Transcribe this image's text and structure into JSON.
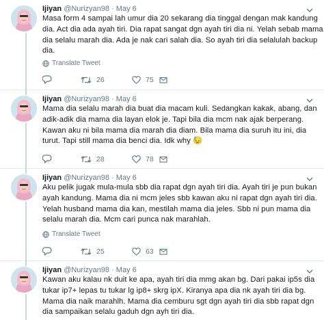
{
  "user": {
    "name": "Ijiyan",
    "handle": "@Nurizyan98",
    "separator": "·"
  },
  "translate_label": "Translate Tweet",
  "tweets": [
    {
      "date": "May 6",
      "lines": [
        "Masa form 4 sampai lah umur dia 20 sekarang dia tinggal dengan mak kandung",
        "dia. Act dia ada ayah tiri. Dia rapat sangat dgn ayah tiri dia ni. Yelah sebab mama",
        "dia selalu marah dia. Ada je nak cari salah dia. So ayah tiri dia selalulah backup",
        "dia."
      ],
      "replies": "",
      "retweets": "26",
      "likes": "75"
    },
    {
      "date": "May 6",
      "lines": [
        "Mama dia selalu marah dia buat dia macam kuli. Sedangkan kakak, abang,  dan",
        "adik-adik dia mama dia layan elok je. Tapi bila dia mcm nak ajak berperang.",
        "Kawan aku ni bila mama dia marah dia diam. Bila mama dia suruh itu ini, dia",
        "turut. Tapi still mama dia benci dia. Idk why"
      ],
      "emoji": "😓",
      "replies": "",
      "retweets": "28",
      "likes": "78"
    },
    {
      "date": "May 6",
      "lines": [
        "Aku pelik jugak mula-mula sbb dia rapat dgn ayah tiri dia. Ayah tiri je pun bukan",
        "ayah kandung. Mama dia ni mcm jeles sbb kawan aku ni rapat dgn ayah tiri dia.",
        "Yelah husband mama dia kan, mestilah mama dia jeles. Sbb ni pun mama dia",
        "selalu marah dia. Mcm cari punca nak marahlah."
      ],
      "replies": "",
      "retweets": "25",
      "likes": "63"
    },
    {
      "date": "May 6",
      "lines": [
        "Kawan aku kalau nk duit ke apa, ayah tiri dia mmg akan bg. Dari pakai ip5s dia",
        "tukar ip7+ lepas tu tukar lg ip8+ skrg ipX. Kiranya apa dia nk ayah tiri dia bg.",
        "Mama dia naik marahlh. Mama dia cemburu sgt dgn ayah tiri dia sbb rapat dgn",
        "dia sampaikan selalu gaduh dgn ayh tiri dia."
      ]
    }
  ],
  "colors": {
    "text": "#14171a",
    "secondary": "#657786",
    "divider": "#e6ecf0",
    "thread_line": "#ccd6dd"
  },
  "icons": {
    "reply": "reply-icon",
    "retweet": "retweet-icon",
    "like": "heart-icon",
    "translate": "globe-icon",
    "caret": "chevron-down-icon"
  }
}
